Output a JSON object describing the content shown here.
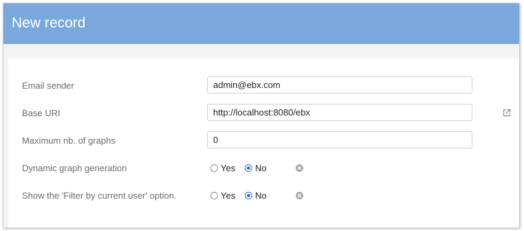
{
  "dialog": {
    "title": "New record"
  },
  "form": {
    "email_sender": {
      "label": "Email sender",
      "value": "admin@ebx.com"
    },
    "base_uri": {
      "label": "Base URI",
      "value": "http://localhost:8080/ebx",
      "link_icon": "external-link-icon"
    },
    "max_graphs": {
      "label": "Maximum nb. of graphs",
      "value": "0"
    },
    "dynamic_graph": {
      "label": "Dynamic graph generation",
      "yes_label": "Yes",
      "no_label": "No",
      "selected": "No",
      "clear_icon": "clear-icon"
    },
    "filter_current_user": {
      "label": "Show the 'Filter by current user' option.",
      "yes_label": "Yes",
      "no_label": "No",
      "selected": "No",
      "clear_icon": "clear-icon"
    }
  },
  "colors": {
    "header": "#7aa7dc",
    "accent": "#3a73c4"
  }
}
